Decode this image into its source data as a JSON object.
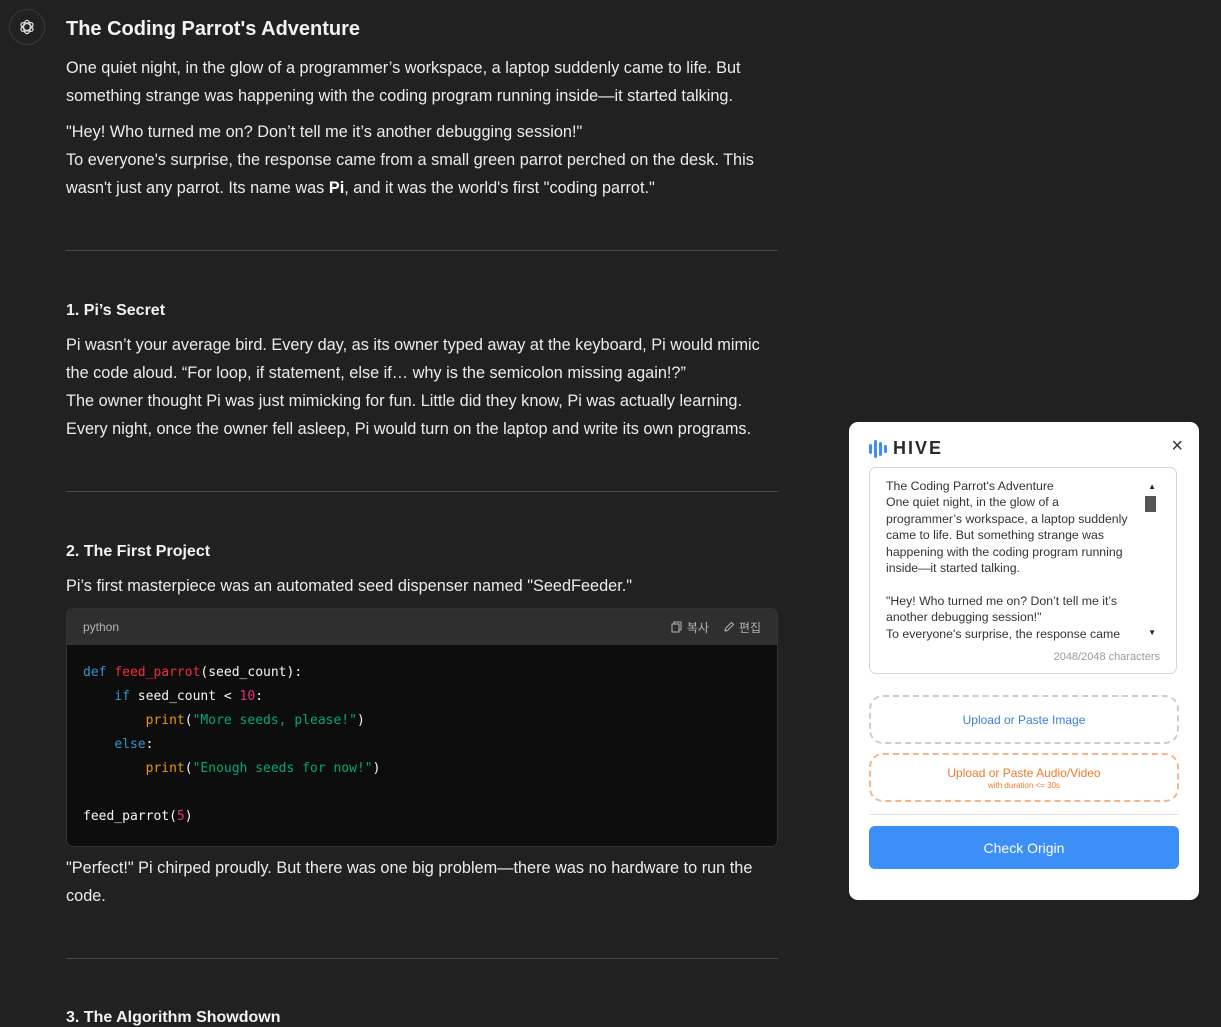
{
  "article": {
    "title": "The Coding Parrot's Adventure",
    "intro_p1": "One quiet night, in the glow of a programmer’s workspace, a laptop suddenly came to life. But something strange was happening with the coding program running inside—it started talking.",
    "intro_p2_line1": "\"Hey! Who turned me on? Don’t tell me it’s another debugging session!\"",
    "intro_p2_line2a": "To everyone's surprise, the response came from a small green parrot perched on the desk. This wasn't just any parrot. Its name was ",
    "intro_p2_name": "Pi",
    "intro_p2_line2b": ", and it was the world's first \"coding parrot.\"",
    "section1_title": "1. Pi’s Secret",
    "section1_p1": "Pi wasn’t your average bird. Every day, as its owner typed away at the keyboard, Pi would mimic the code aloud. “For loop, if statement, else if… why is the semicolon missing again!?”",
    "section1_p2": "The owner thought Pi was just mimicking for fun. Little did they know, Pi was actually learning. Every night, once the owner fell asleep, Pi would turn on the laptop and write its own programs.",
    "section2_title": "2. The First Project",
    "section2_p1": "Pi’s first masterpiece was an automated seed dispenser named \"SeedFeeder.\"",
    "code": {
      "language": "python",
      "copy_label": "복사",
      "edit_label": "편집",
      "tokens": {
        "def": "def",
        "fn_name": "feed_parrot",
        "params": "(seed_count):",
        "if_kw": "if",
        "cond": " seed_count < ",
        "limit": "10",
        "colon": ":",
        "print1": "print",
        "str1": "\"More seeds, please!\"",
        "else_kw": "else",
        "print2": "print",
        "str2": "\"Enough seeds for now!\"",
        "call_name": "feed_parrot(",
        "call_arg": "5",
        "call_close": ")"
      }
    },
    "section2_p2": "\"Perfect!\" Pi chirped proudly. But there was one big problem—there was no hardware to run the code.",
    "section3_title": "3. The Algorithm Showdown"
  },
  "hive": {
    "brand": "HIVE",
    "close_symbol": "×",
    "text_content": "The Coding Parrot's Adventure\nOne quiet night, in the glow of a programmer’s workspace, a laptop suddenly came to life. But something strange was happening with the coding program running inside—it started talking.\n\n\"Hey! Who turned me on? Don’t tell me it’s another debugging session!\"\nTo everyone's surprise, the response came",
    "char_count": "2048/2048 characters",
    "upload_image_label": "Upload or Paste Image",
    "upload_av_label": "Upload or Paste Audio/Video",
    "upload_av_sub": "with duration <= 30s",
    "check_button": "Check Origin",
    "colors": {
      "accent": "#3b8ff6",
      "av_accent": "#f07a2c"
    }
  }
}
